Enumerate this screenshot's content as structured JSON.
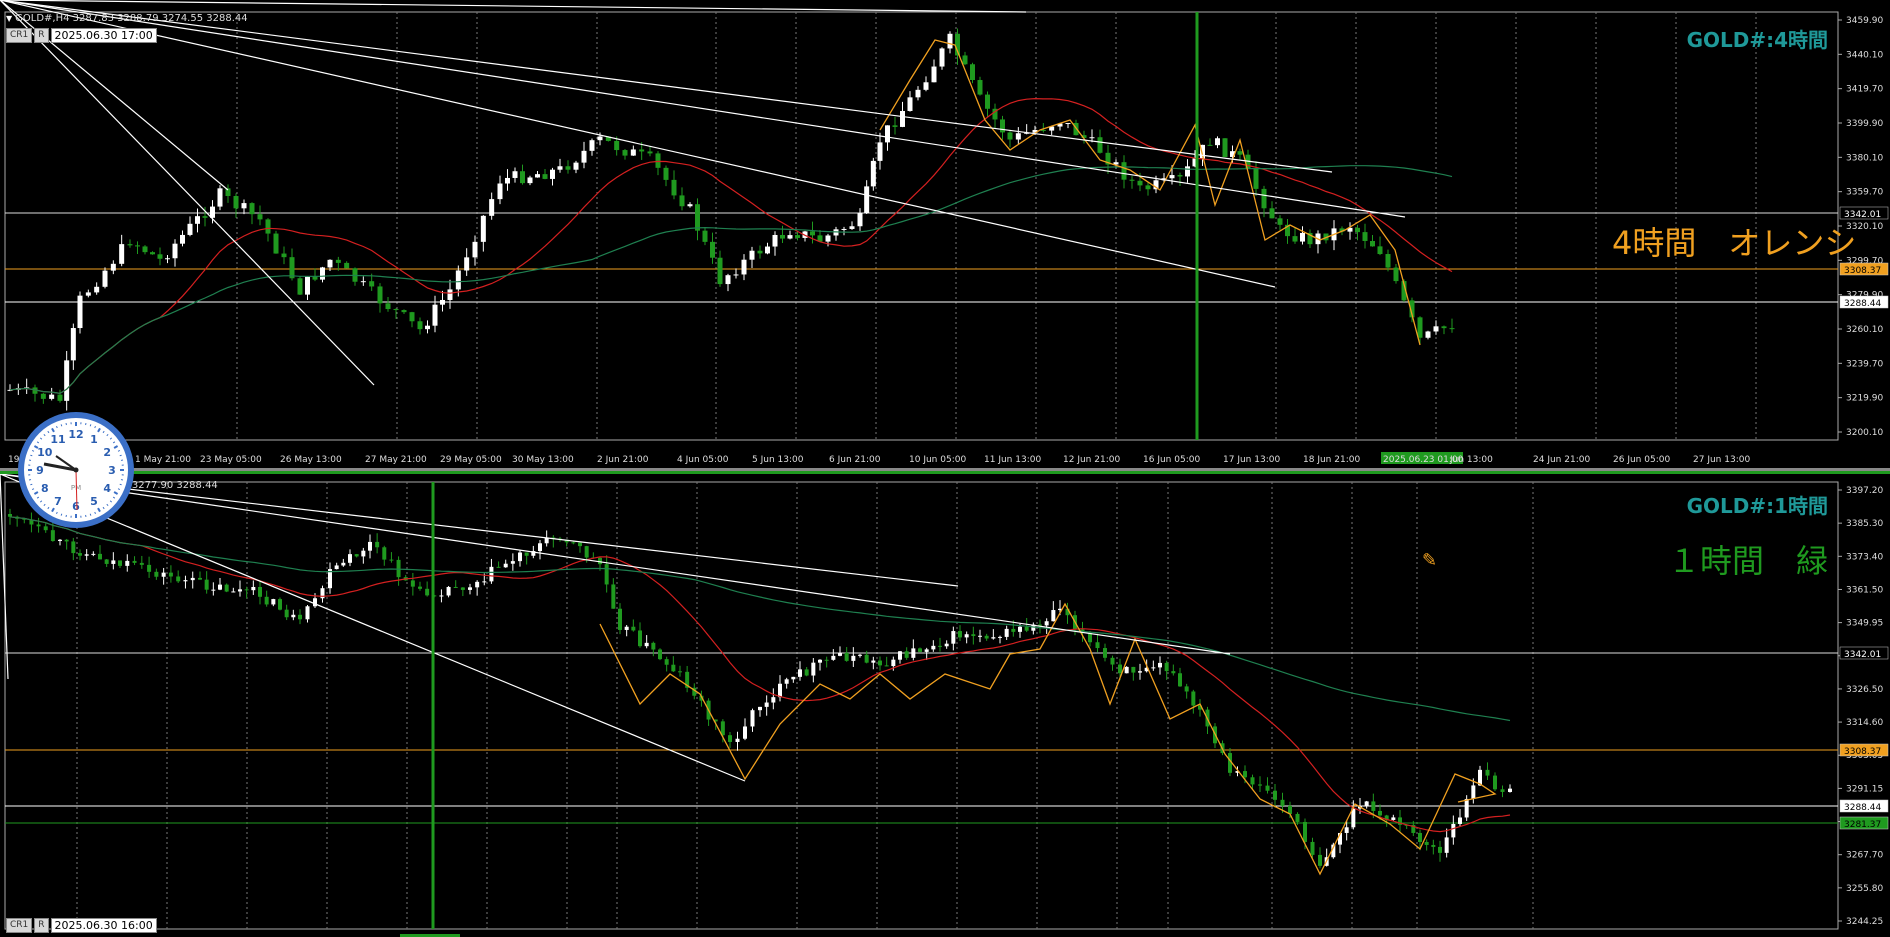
{
  "top": {
    "info": "GOLD#,H4  3287.83 3288.79 3274.55 3288.44",
    "btn1": "CR1",
    "btn2": "R",
    "date": "2025.06.30 17:00",
    "title": "GOLD#:4時間",
    "annotation": "4時間　オレンシ",
    "annotation_color": "#f0a020",
    "ylabels": [
      "3459.90",
      "3440.10",
      "3419.70",
      "3399.90",
      "3380.10",
      "3359.70",
      "3320.10",
      "3299.70",
      "3279.90",
      "3260.10",
      "3239.70",
      "3219.90",
      "3200.10"
    ],
    "price_boxes": [
      {
        "label": "3342.01",
        "color": "#ffffff",
        "bg": "#000000"
      },
      {
        "label": "3308.37",
        "color": "#000000",
        "bg": "#f0a020"
      },
      {
        "label": "3288.44",
        "color": "#000000",
        "bg": "#ffffff"
      }
    ],
    "xlabels": [
      "19",
      "1 May 21:00",
      "23 May 05:00",
      "26 May 13:00",
      "27 May 21:00",
      "29 May 05:00",
      "30 May 13:00",
      "2 Jun 21:00",
      "4 Jun 05:00",
      "5 Jun 13:00",
      "6 Jun 21:00",
      "10 Jun 05:00",
      "11 Jun 13:00",
      "12 Jun 21:00",
      "16 Jun 05:00",
      "17 Jun 13:00",
      "18 Jun 21:00",
      "2025.06.23 01:00",
      "Jun 13:00",
      "24 Jun 21:00",
      "26 Jun 05:00",
      "27 Jun 13:00"
    ]
  },
  "bottom": {
    "info": "78 3277.90 3288.44",
    "btn1": "CR1",
    "btn2": "R",
    "date": "2025.06.30 16:00",
    "title": "GOLD#:1時間",
    "annotation": "１時間　緑",
    "annotation_color": "#1f9a1f",
    "ylabels": [
      "3397.20",
      "3385.30",
      "3373.40",
      "3361.50",
      "3349.95",
      "3338.40",
      "3326.50",
      "3314.60",
      "3303.05",
      "3291.15",
      "3279.25",
      "3267.70",
      "3255.80",
      "3244.25"
    ],
    "price_boxes": [
      {
        "label": "3342.01",
        "color": "#ffffff",
        "bg": "#000000"
      },
      {
        "label": "3308.37",
        "color": "#000000",
        "bg": "#f0a020"
      },
      {
        "label": "3288.44",
        "color": "#000000",
        "bg": "#ffffff"
      },
      {
        "label": "3281.37",
        "color": "#000000",
        "bg": "#1f9a1f"
      }
    ]
  },
  "clock": {
    "numbers": [
      "12",
      "1",
      "2",
      "3",
      "4",
      "5",
      "6",
      "7",
      "8",
      "9",
      "10",
      "11"
    ],
    "label": "PM"
  },
  "colors": {
    "candle": "#ffffff",
    "candle_dn": "#1f9a1f",
    "ma_red": "#d42020",
    "ma_green": "#1f8050",
    "zigzag": "#f0a020",
    "grid": "#777777",
    "trend": "#ffffff"
  }
}
